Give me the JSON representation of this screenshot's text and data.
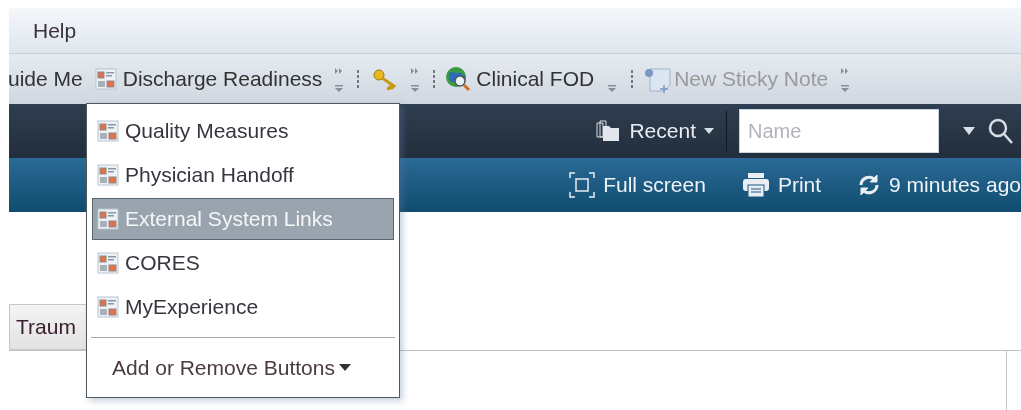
{
  "menu_bar": {
    "items": [
      "Help"
    ]
  },
  "toolbar": {
    "items": [
      {
        "kind": "text",
        "label": "uide Me",
        "disabled": false
      },
      {
        "kind": "doc",
        "label": "Discharge Readiness",
        "disabled": false
      },
      {
        "kind": "overflow"
      },
      {
        "kind": "key"
      },
      {
        "kind": "overflow"
      },
      {
        "kind": "globe",
        "label": "Clinical FOD",
        "disabled": false
      },
      {
        "kind": "chevron"
      },
      {
        "kind": "note",
        "label": "New Sticky Note",
        "disabled": true
      },
      {
        "kind": "overflow"
      }
    ]
  },
  "nav_bar": {
    "recent": "Recent",
    "search": {
      "placeholder": "Name"
    }
  },
  "action_bar": {
    "items": [
      {
        "kind": "fullscreen",
        "label": "Full screen"
      },
      {
        "kind": "print",
        "label": "Print"
      },
      {
        "kind": "refresh",
        "label": "9 minutes ago"
      }
    ]
  },
  "tab": {
    "label": "Traum"
  },
  "dropdown": {
    "items": [
      {
        "label": "Quality Measures",
        "selected": false
      },
      {
        "label": "Physician Handoff",
        "selected": false
      },
      {
        "label": "External System Links",
        "selected": true
      },
      {
        "label": "CORES",
        "selected": false
      },
      {
        "label": "MyExperience",
        "selected": false
      }
    ],
    "footer": "Add or Remove Buttons"
  }
}
